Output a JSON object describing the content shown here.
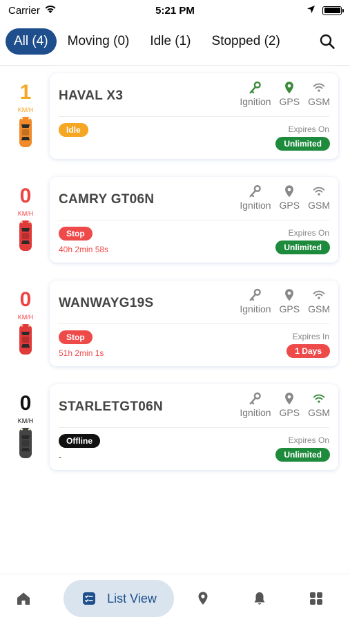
{
  "status_bar": {
    "carrier": "Carrier",
    "time": "5:21 PM"
  },
  "filters": [
    {
      "label": "All (4)",
      "active": true
    },
    {
      "label": "Moving (0)",
      "active": false
    },
    {
      "label": "Idle (1)",
      "active": false
    },
    {
      "label": "Stopped (2)",
      "active": false
    }
  ],
  "vehicles": [
    {
      "speed": "1",
      "speed_unit": "KM/H",
      "speed_color": "#f5a623",
      "car_color": "#f08a2a",
      "name": "HAVAL X3",
      "ignition_label": "Ignition",
      "gps_label": "GPS",
      "gsm_label": "GSM",
      "ignition_color": "#3a8a3a",
      "gps_color": "#3a8a3a",
      "gsm_color": "#888888",
      "status": "Idle",
      "status_color": "#f5a623",
      "duration": "",
      "expire_label": "Expires On",
      "expire_value": "Unlimited",
      "expire_color": "#1e8a3c"
    },
    {
      "speed": "0",
      "speed_unit": "KM/H",
      "speed_color": "#ef4444",
      "car_color": "#e03a3a",
      "name": "CAMRY GT06N",
      "ignition_label": "Ignition",
      "gps_label": "GPS",
      "gsm_label": "GSM",
      "ignition_color": "#888888",
      "gps_color": "#888888",
      "gsm_color": "#888888",
      "status": "Stop",
      "status_color": "#ef4a4a",
      "duration": "40h 2min 58s",
      "expire_label": "Expires On",
      "expire_value": "Unlimited",
      "expire_color": "#1e8a3c"
    },
    {
      "speed": "0",
      "speed_unit": "KM/H",
      "speed_color": "#ef4444",
      "car_color": "#e03a3a",
      "name": "WANWAYG19S",
      "ignition_label": "Ignition",
      "gps_label": "GPS",
      "gsm_label": "GSM",
      "ignition_color": "#888888",
      "gps_color": "#888888",
      "gsm_color": "#888888",
      "status": "Stop",
      "status_color": "#ef4a4a",
      "duration": "51h 2min 1s",
      "expire_label": "Expires In",
      "expire_value": "1 Days",
      "expire_color": "#ef4a4a"
    },
    {
      "speed": "0",
      "speed_unit": "KM/H",
      "speed_color": "#111111",
      "car_color": "#444444",
      "name": "STARLETGT06N",
      "ignition_label": "Ignition",
      "gps_label": "GPS",
      "gsm_label": "GSM",
      "ignition_color": "#888888",
      "gps_color": "#888888",
      "gsm_color": "#3a8a3a",
      "status": "Offline",
      "status_color": "#111111",
      "duration": "-",
      "expire_label": "Expires On",
      "expire_value": "Unlimited",
      "expire_color": "#1e8a3c"
    }
  ],
  "bottom_nav": {
    "list_view_label": "List View"
  },
  "icons": {
    "filter_search": "search-icon",
    "nav": [
      "home-icon",
      "list-view-icon",
      "map-pin-icon",
      "bell-icon",
      "grid-icon"
    ],
    "card": [
      "key-icon",
      "location-pin-icon",
      "wifi-icon",
      "car-icon"
    ]
  },
  "colors": {
    "accent": "#1e4f8c",
    "active_tab_bg": "#1e4f8c",
    "nav_active_bg": "#d9e4ee"
  }
}
